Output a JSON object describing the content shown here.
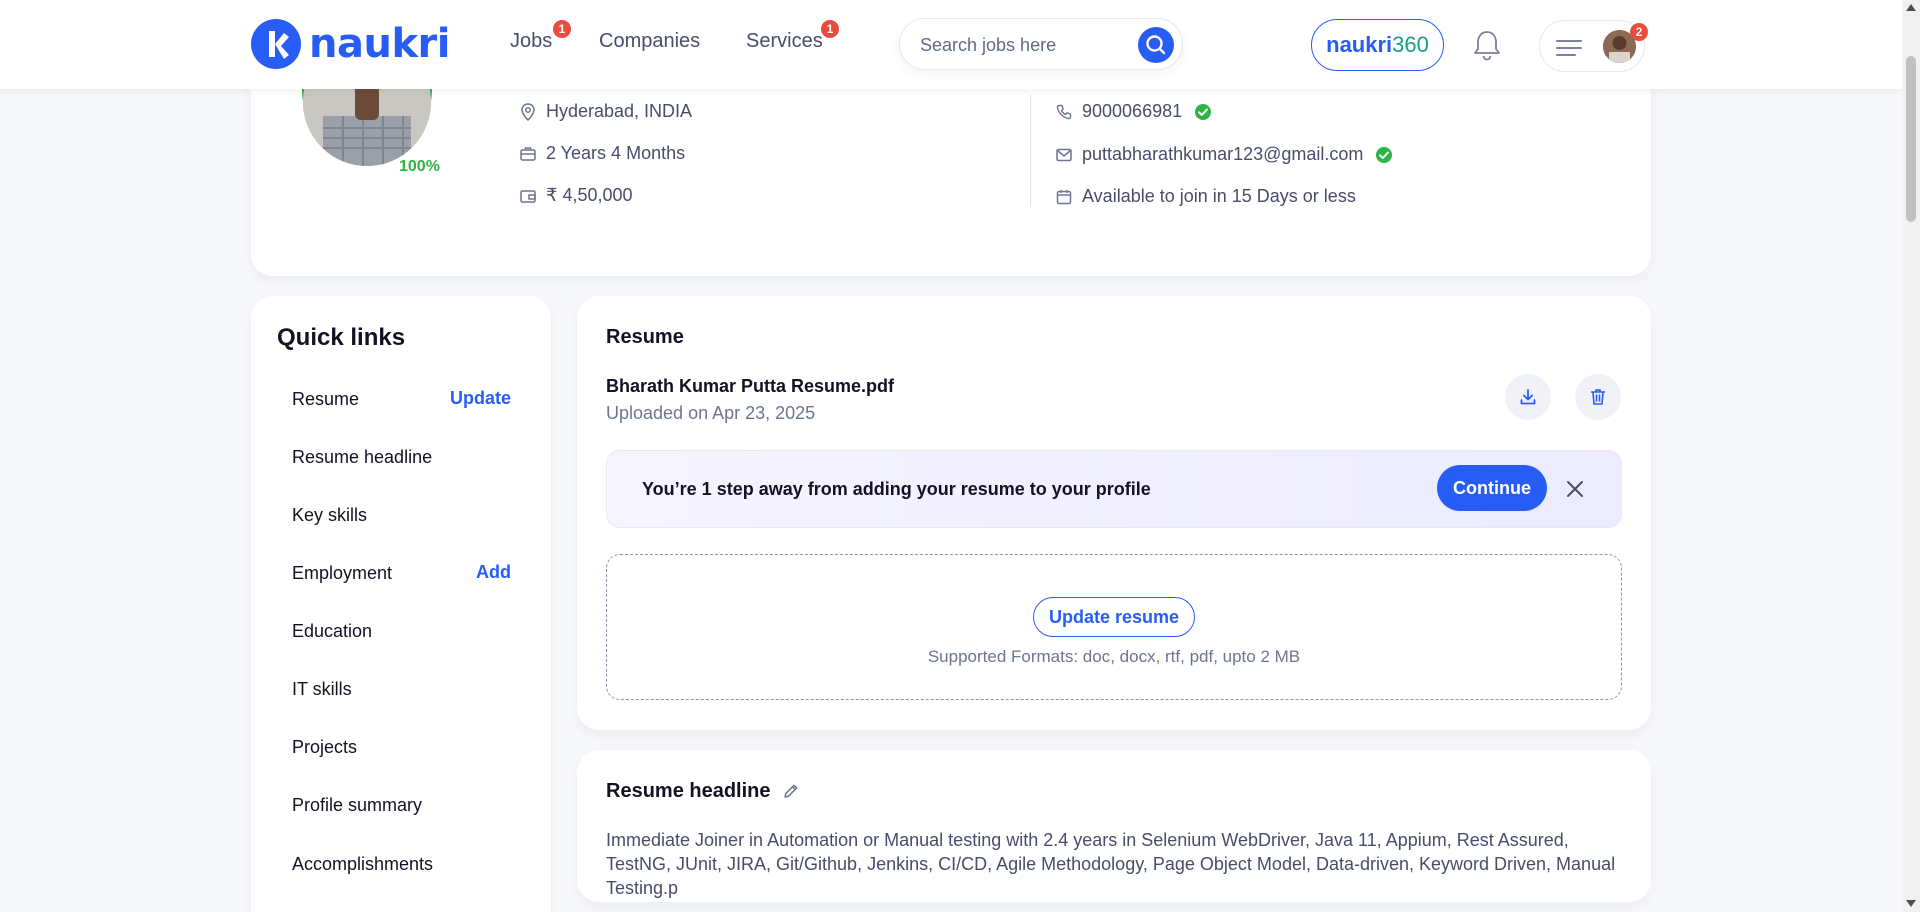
{
  "header": {
    "logo_text": "naukri",
    "nav": {
      "jobs": {
        "label": "Jobs",
        "badge": "1"
      },
      "companies": {
        "label": "Companies"
      },
      "services": {
        "label": "Services",
        "badge": "1"
      }
    },
    "search": {
      "placeholder": "Search jobs here"
    },
    "naukri360": {
      "part1": "naukri",
      "part2": "360"
    },
    "menu_badge": "2"
  },
  "profile": {
    "completion": "100%",
    "location": "Hyderabad, INDIA",
    "experience": "2 Years 4 Months",
    "salary": "₹ 4,50,000",
    "phone": "9000066981",
    "email": "puttabharathkumar123@gmail.com",
    "availability": "Available to join in 15 Days or less"
  },
  "quick_links": {
    "title": "Quick links",
    "items": [
      {
        "label": "Resume",
        "action": "Update"
      },
      {
        "label": "Resume headline",
        "action": ""
      },
      {
        "label": "Key skills",
        "action": ""
      },
      {
        "label": "Employment",
        "action": "Add"
      },
      {
        "label": "Education",
        "action": ""
      },
      {
        "label": "IT skills",
        "action": ""
      },
      {
        "label": "Projects",
        "action": ""
      },
      {
        "label": "Profile summary",
        "action": ""
      },
      {
        "label": "Accomplishments",
        "action": ""
      }
    ]
  },
  "resume": {
    "title": "Resume",
    "file_name": "Bharath Kumar Putta Resume.pdf",
    "uploaded": "Uploaded on Apr 23, 2025",
    "banner_text": "You’re 1 step away from adding your resume to your profile",
    "continue_label": "Continue",
    "update_label": "Update resume",
    "formats": "Supported Formats: doc, docx, rtf, pdf, upto 2 MB"
  },
  "headline": {
    "title": "Resume headline",
    "text": "Immediate Joiner in Automation or Manual testing with 2.4 years in Selenium WebDriver, Java 11, Appium, Rest Assured, TestNG, JUnit, JIRA, Git/Github, Jenkins, CI/CD, Agile Methodology, Page Object Model, Data-driven, Keyword Driven, Manual Testing.p"
  },
  "colors": {
    "brand": "#275df5",
    "success": "#2fb344",
    "badge": "#e74c3c"
  }
}
